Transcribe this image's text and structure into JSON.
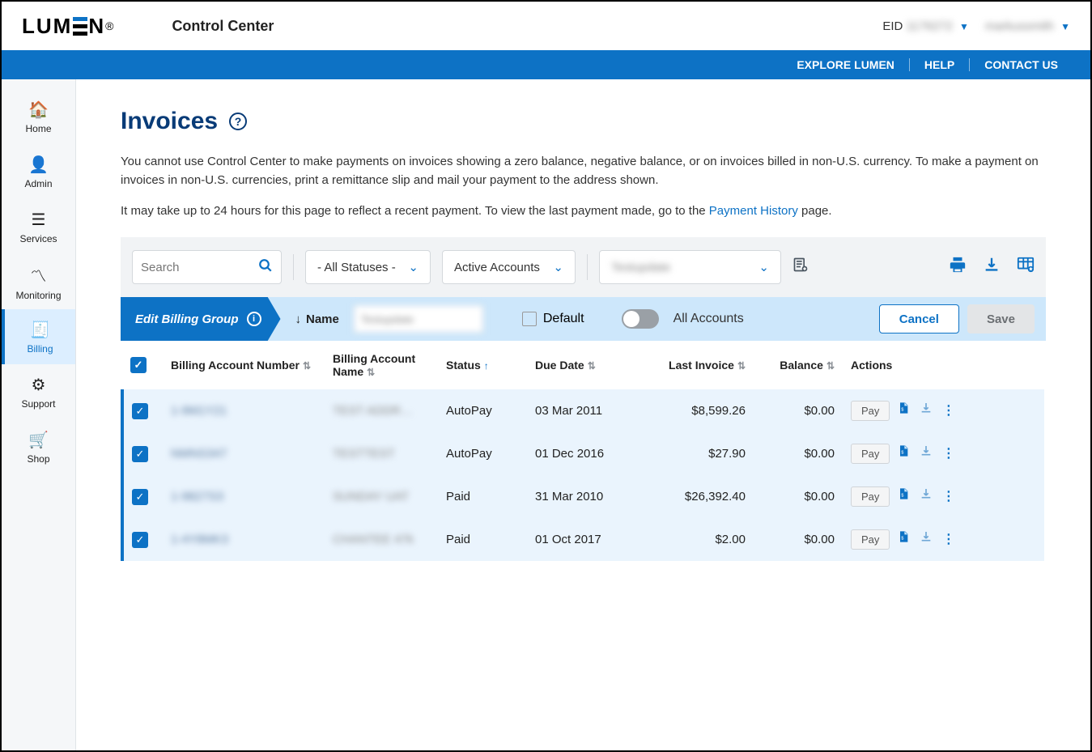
{
  "header": {
    "logo_text": "LUMEN",
    "app_title": "Control Center",
    "eid_label": "EID",
    "eid_value": "1176272",
    "user_name": "markussmith"
  },
  "bluebar": {
    "explore": "EXPLORE LUMEN",
    "help": "HELP",
    "contact": "CONTACT US"
  },
  "sidebar": {
    "items": [
      {
        "label": "Home",
        "icon": "🏠"
      },
      {
        "label": "Admin",
        "icon": "👤"
      },
      {
        "label": "Services",
        "icon": "☰"
      },
      {
        "label": "Monitoring",
        "icon": "〽"
      },
      {
        "label": "Billing",
        "icon": "🧾"
      },
      {
        "label": "Support",
        "icon": "⚙"
      },
      {
        "label": "Shop",
        "icon": "🛒"
      }
    ],
    "active_index": 4
  },
  "page": {
    "title": "Invoices",
    "desc": "You cannot use Control Center to make payments on invoices showing a zero balance, negative balance, or on invoices billed in non‑U.S. currency. To make a payment on invoices in non‑U.S. currencies, print a remittance slip and mail your payment to the address shown.",
    "desc2_pre": "It may take up to 24 hours for this page to reflect a recent payment. To view the last payment made, go to the ",
    "desc2_link": "Payment History",
    "desc2_post": " page."
  },
  "toolbar": {
    "search_placeholder": "Search",
    "status_filter": "- All Statuses -",
    "account_filter": "Active Accounts",
    "group_filter": "Testupdate"
  },
  "editbar": {
    "chip_label": "Edit Billing Group",
    "name_label": "Name",
    "name_value": "Testupdate",
    "default_label": "Default",
    "all_accounts_label": "All Accounts",
    "cancel": "Cancel",
    "save": "Save"
  },
  "table": {
    "headers": {
      "acct_num": "Billing Account Number",
      "acct_name": "Billing Account Name",
      "status": "Status",
      "due": "Due Date",
      "last": "Last Invoice",
      "balance": "Balance",
      "actions": "Actions"
    },
    "rows": [
      {
        "num": "1-9M1Y21",
        "name": "TEST ADDR…",
        "status": "AutoPay",
        "due": "03 Mar 2011",
        "last": "$8,599.26",
        "balance": "$0.00"
      },
      {
        "num": "NMNS347",
        "name": "TESTTEST",
        "status": "AutoPay",
        "due": "01 Dec 2016",
        "last": "$27.90",
        "balance": "$0.00"
      },
      {
        "num": "1-9827S3",
        "name": "SUNDAY UAT",
        "status": "Paid",
        "due": "31 Mar 2010",
        "last": "$26,392.40",
        "balance": "$0.00"
      },
      {
        "num": "1-4Y8MK3",
        "name": "CHANTEE 47k",
        "status": "Paid",
        "due": "01 Oct 2017",
        "last": "$2.00",
        "balance": "$0.00"
      }
    ],
    "pay_label": "Pay"
  }
}
